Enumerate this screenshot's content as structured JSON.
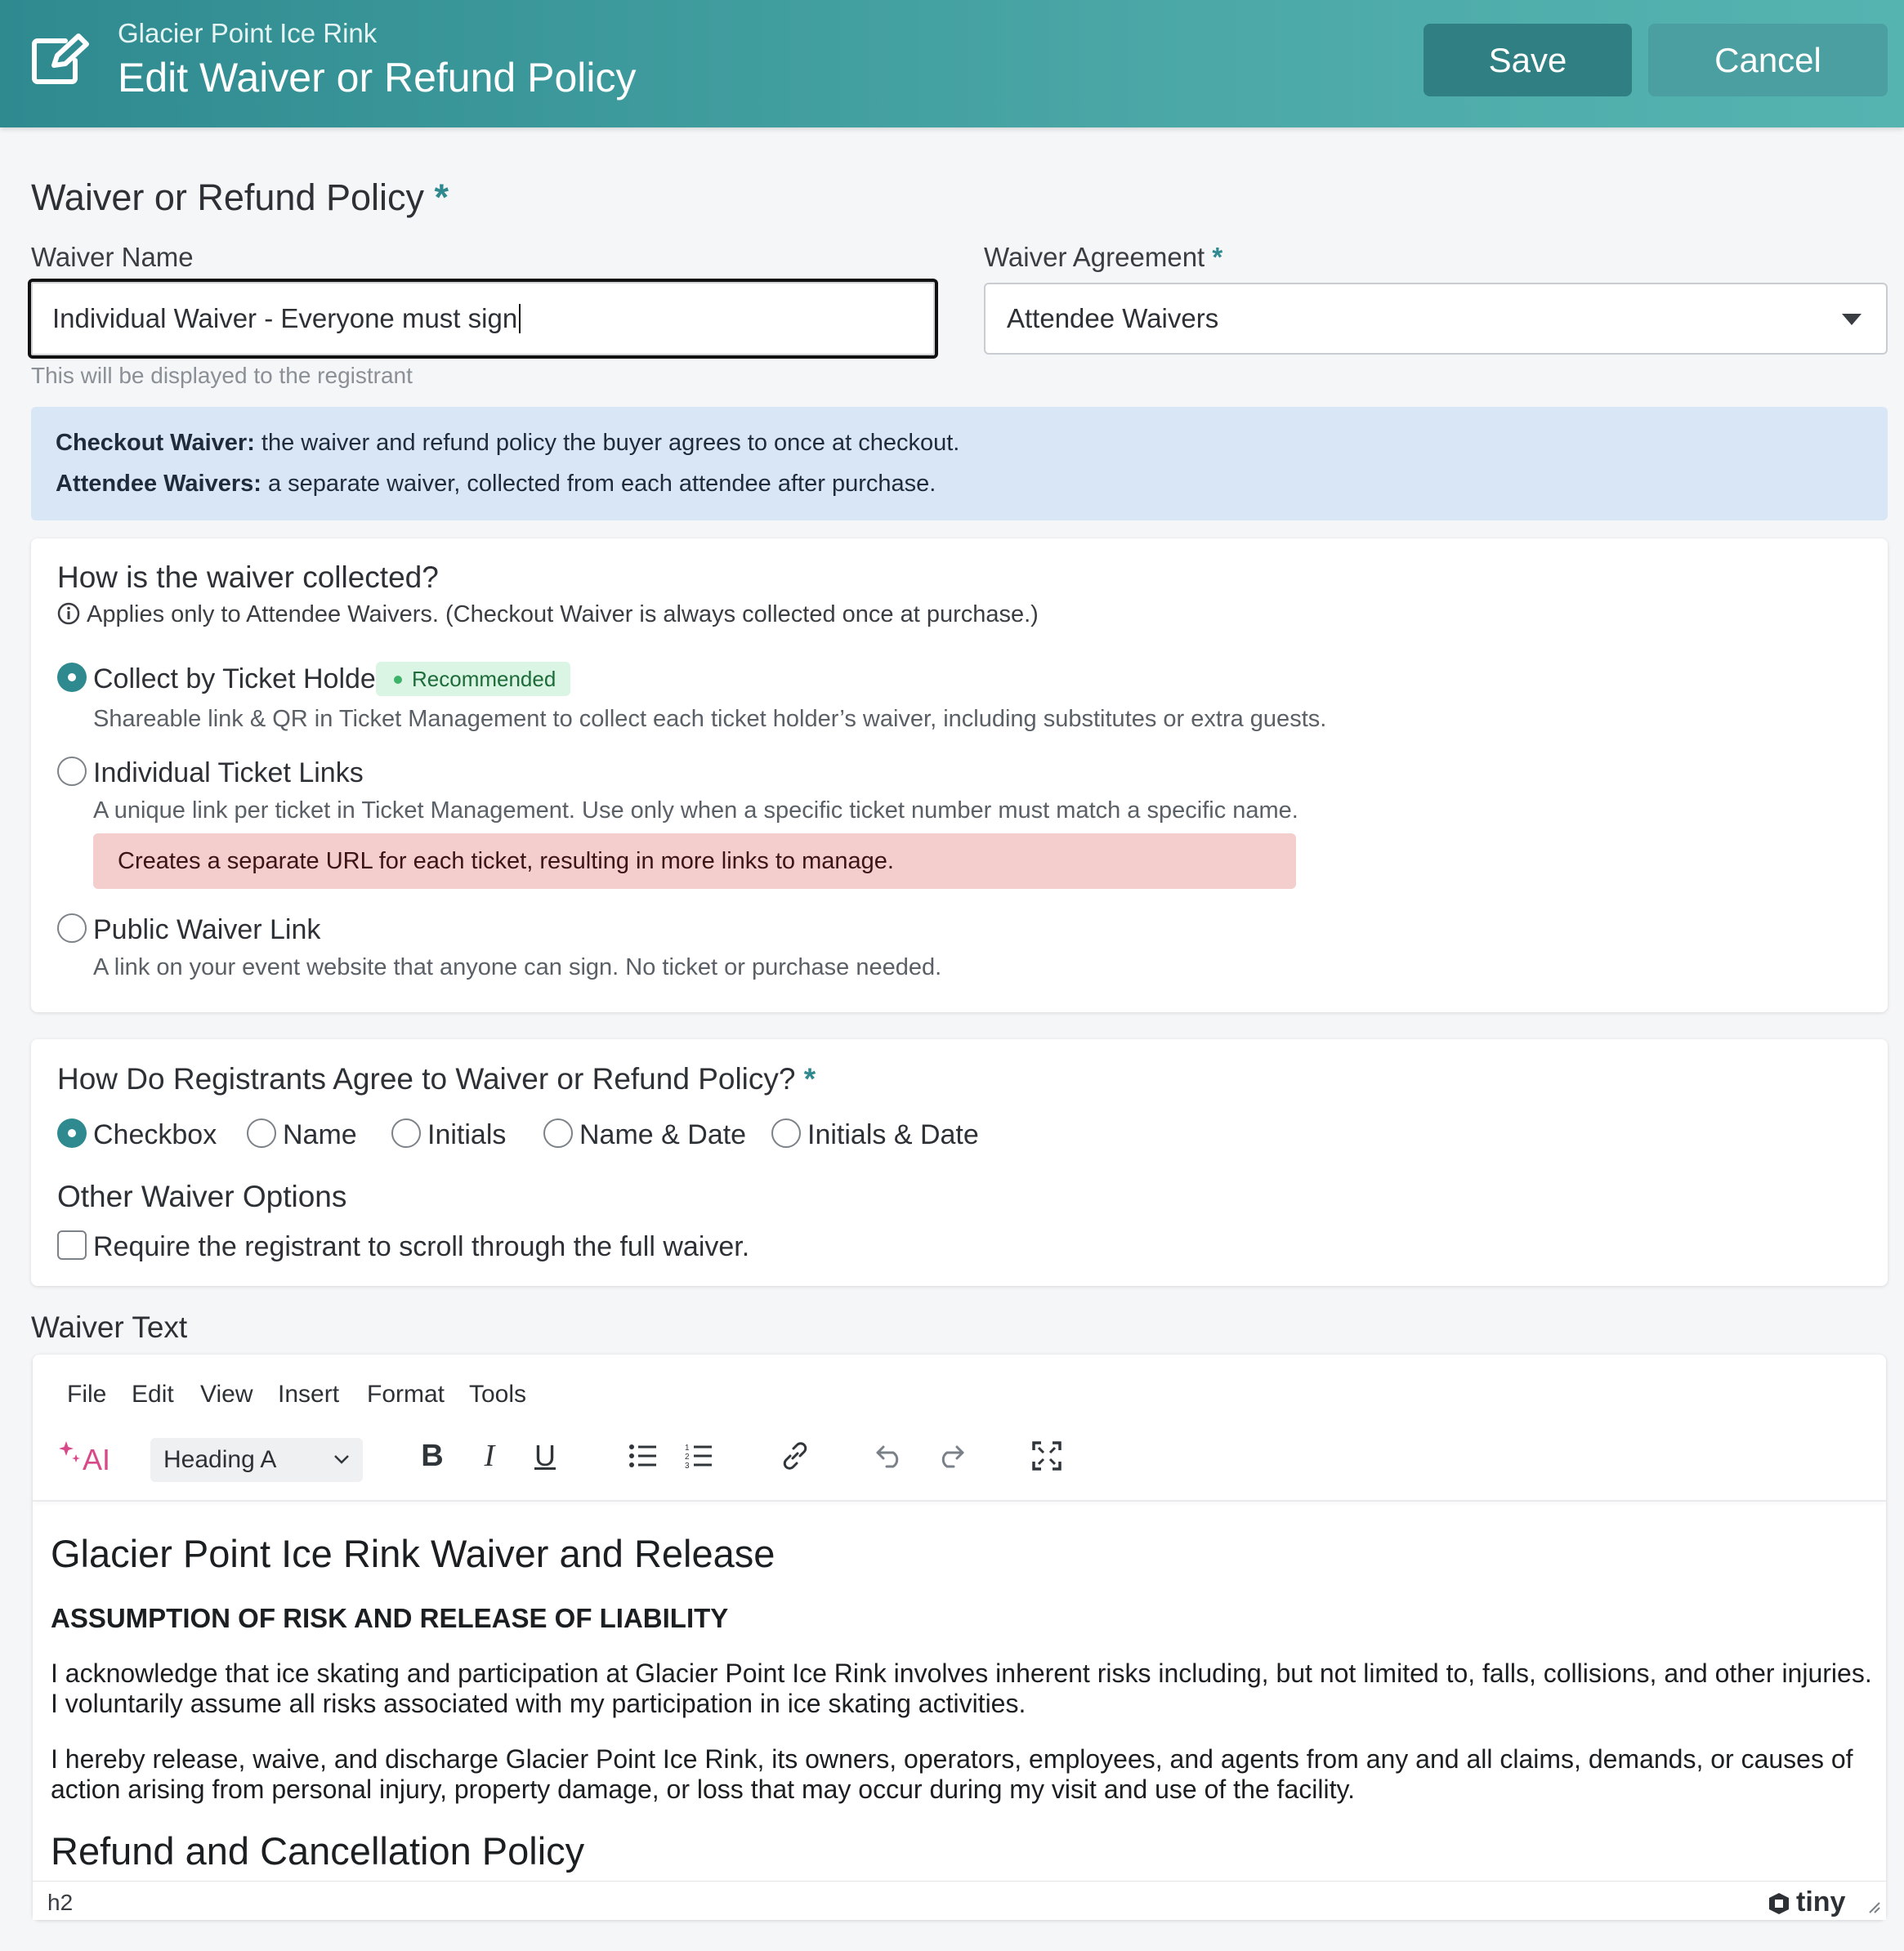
{
  "header": {
    "subtitle": "Glacier Point Ice Rink",
    "title": "Edit Waiver or Refund Policy",
    "save_label": "Save",
    "cancel_label": "Cancel"
  },
  "policy": {
    "section_title": "Waiver or Refund Policy",
    "required_mark": "*",
    "waiver_name_label": "Waiver Name",
    "waiver_name_value": "Individual Waiver - Everyone must sign",
    "waiver_name_helper": "This will be displayed to the registrant",
    "agreement_label": "Waiver Agreement",
    "agreement_value": "Attendee Waivers"
  },
  "info": {
    "checkout_term": "Checkout Waiver:",
    "checkout_text": " the waiver and refund policy the buyer agrees to once at checkout.",
    "attendee_term": "Attendee Waivers:",
    "attendee_text": " a separate waiver, collected from each attendee after purchase."
  },
  "collection": {
    "question": "How is the waiver collected?",
    "note": "Applies only to Attendee Waivers. (Checkout Waiver is always collected once at purchase.)",
    "options": [
      {
        "label": "Collect by Ticket Holder",
        "badge": "Recommended",
        "desc": "Shareable link & QR in Ticket Management to collect each ticket holder’s waiver, including substitutes or extra guests.",
        "selected": true
      },
      {
        "label": "Individual Ticket Links",
        "desc": "A unique link per ticket in Ticket Management. Use only when a specific ticket number must match a specific name.",
        "warning": "Creates a separate URL for each ticket, resulting in more links to manage.",
        "selected": false
      },
      {
        "label": "Public Waiver Link",
        "desc": "A link on your event website that anyone can sign. No ticket or purchase needed.",
        "selected": false
      }
    ]
  },
  "agreement": {
    "question": "How Do Registrants Agree to Waiver or Refund Policy?",
    "options": [
      "Checkbox",
      "Name",
      "Initials",
      "Name & Date",
      "Initials & Date"
    ],
    "selected": "Checkbox",
    "other_title": "Other Waiver Options",
    "scroll_label": "Require the registrant to scroll through the full waiver."
  },
  "editor": {
    "section_label": "Waiver Text",
    "menu": [
      "File",
      "Edit",
      "View",
      "Insert",
      "Format",
      "Tools"
    ],
    "ai_label": "AI",
    "block_format": "Heading A",
    "heading": "Glacier Point Ice Rink Waiver and Release",
    "subheading": "ASSUMPTION OF RISK AND RELEASE OF LIABILITY",
    "para1": "I acknowledge that ice skating and participation at Glacier Point Ice Rink involves inherent risks including, but not limited to, falls, collisions, and other injuries. I voluntarily assume all risks associated with my participation in ice skating activities.",
    "para2": "I hereby release, waive, and discharge Glacier Point Ice Rink, its owners, operators, employees, and agents from any and all claims, demands, or causes of action arising from personal injury, property damage, or loss that may occur during my visit and use of the facility.",
    "heading2": "Refund and Cancellation Policy",
    "status_path": "h2",
    "brand": "tiny"
  },
  "colors": {
    "accent": "#2e8a8f",
    "info_bg": "#d8e6f5",
    "warn_bg": "#f4cdcd",
    "badge_bg": "#daf5e3"
  }
}
